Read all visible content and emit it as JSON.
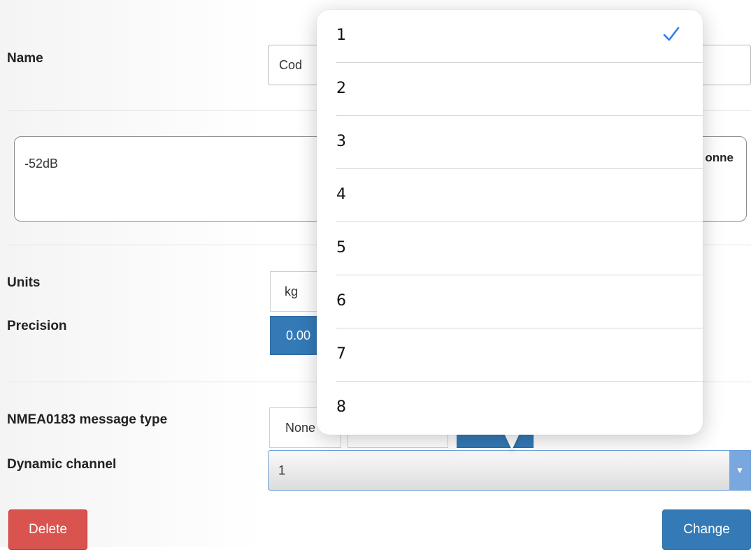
{
  "form": {
    "name_label": "Name",
    "name_value": "Cod",
    "textarea_value": "-52dB",
    "textarea_right_text": "onne",
    "units_label": "Units",
    "units_value": "kg",
    "precision_label": "Precision",
    "precision_selected": "0.00",
    "nmea_label": "NMEA0183 message type",
    "nmea_selected": "None",
    "dynamic_channel_label": "Dynamic channel",
    "dynamic_channel_value": "1"
  },
  "buttons": {
    "delete_label": "Delete",
    "change_label": "Change"
  },
  "picker": {
    "options": [
      "1",
      "2",
      "3",
      "4",
      "5",
      "6",
      "7",
      "8"
    ],
    "selected": "1"
  },
  "colors": {
    "primary": "#337ab7",
    "danger": "#d9534f",
    "check": "#2f7cf6"
  }
}
